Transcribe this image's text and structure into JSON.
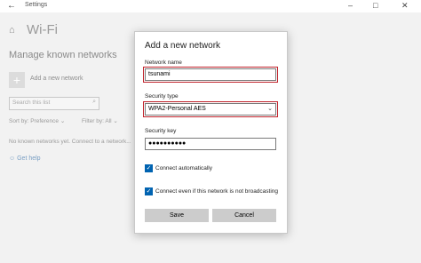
{
  "window": {
    "title": "Settings",
    "back_glyph": "←",
    "minimize_glyph": "–",
    "maximize_glyph": "□",
    "close_glyph": "✕"
  },
  "page": {
    "home_glyph": "⌂",
    "title": "Wi-Fi",
    "section_heading": "Manage known networks",
    "add_button_glyph": "+",
    "add_label": "Add a new network",
    "search_placeholder": "Search this list",
    "search_glyph": "⌕",
    "sort_label": "Sort by:",
    "sort_value": "Preference",
    "filter_label": "Filter by:",
    "filter_value": "All",
    "chevron": "⌄",
    "empty_text": "No known networks yet. Connect to a network...",
    "help_glyph": "☺",
    "help_label": "Get help"
  },
  "dialog": {
    "title": "Add a new network",
    "network_name_label": "Network name",
    "network_name_value": "tsunami",
    "security_type_label": "Security type",
    "security_type_value": "WPA2-Personal AES",
    "security_key_label": "Security key",
    "security_key_value": "●●●●●●●●●●",
    "check_glyph": "✓",
    "connect_auto_label": "Connect automatically",
    "connect_even_label": "Connect even if this network is not broadcasting",
    "save_label": "Save",
    "cancel_label": "Cancel"
  },
  "colors": {
    "highlight": "#c0232b",
    "accent": "#0063b1"
  }
}
